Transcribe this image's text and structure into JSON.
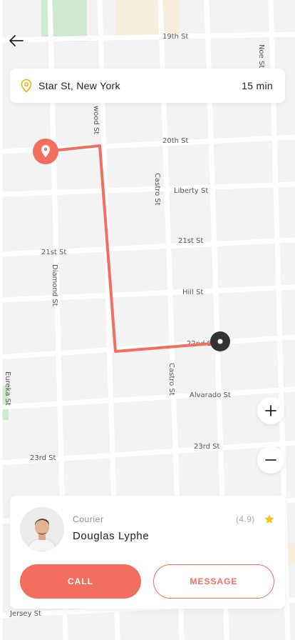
{
  "map": {
    "streets": [
      "19th St",
      "20th St",
      "Liberty St",
      "21st St",
      "21st St",
      "Hill St",
      "22nd St",
      "Alvarado St",
      "23rd St",
      "23rd St",
      "Jersey St",
      "Castro St",
      "Castro St",
      "Diamond St",
      "Eureka St",
      "Noe St",
      "wood St"
    ],
    "route_color": "#f26e5f",
    "origin_color": "#f26e5f",
    "destination_color": "#333333"
  },
  "header": {
    "back_icon": "arrow-left-icon"
  },
  "location": {
    "address": "Star St, New York",
    "eta": "15 min",
    "pin_icon": "map-pin-icon",
    "pin_color": "#e8b923"
  },
  "zoom": {
    "in_icon": "plus-icon",
    "out_icon": "minus-icon"
  },
  "courier": {
    "role": "Courier",
    "name": "Douglas Lyphe",
    "rating": "(4.9)",
    "star_icon": "star-icon",
    "star_color": "#f5c518",
    "call_label": "CALL",
    "message_label": "MESSAGE",
    "accent": "#f26e5f"
  }
}
